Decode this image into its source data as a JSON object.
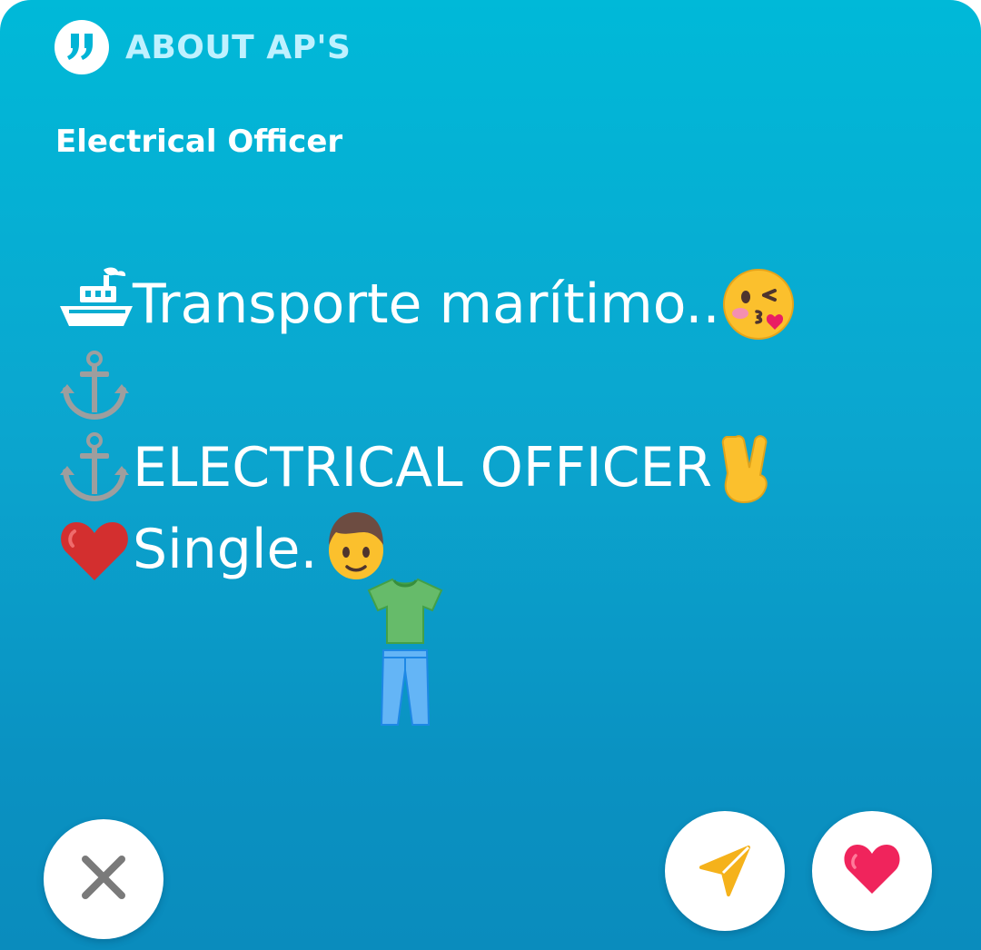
{
  "header": {
    "icon": "quote-icon",
    "title": "ABOUT AP'S"
  },
  "job_title": "Electrical Officer",
  "bio": {
    "line1_text": "Transporte marítimo..",
    "line3_text": " ELECTRICAL OFFICER",
    "line4_text": " Single. ",
    "emojis": [
      "ship-icon",
      "kissing-face-icon",
      "anchor-icon",
      "anchor-icon",
      "victory-hand-icon",
      "red-heart-icon",
      "man-icon",
      "t-shirt-icon",
      "jeans-icon"
    ]
  },
  "actions": {
    "close_icon": "close-icon",
    "send_icon": "send-icon",
    "like_icon": "heart-icon"
  },
  "colors": {
    "background_top": "#00b9d8",
    "background_bottom": "#0a8cbd",
    "header_text": "#bff1ff",
    "close": "#7a7a7a",
    "send": "#f5b21b",
    "like": "#f0245c"
  }
}
